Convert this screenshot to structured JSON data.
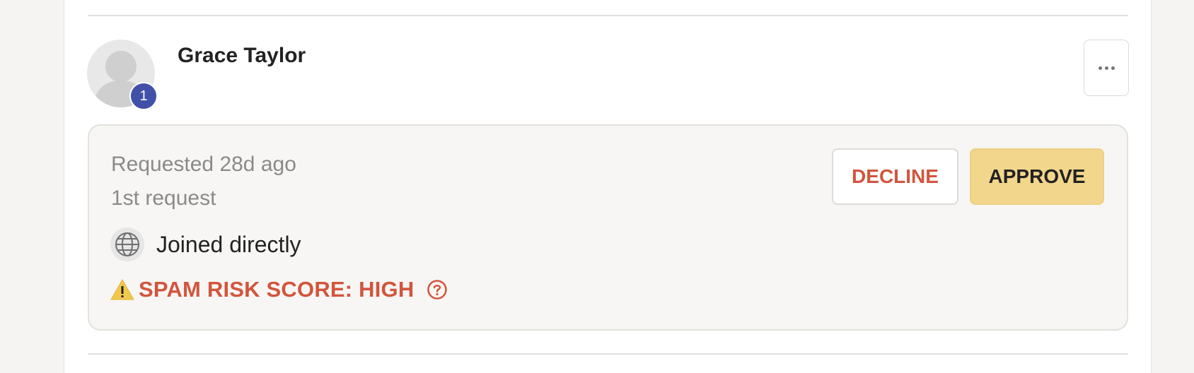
{
  "member": {
    "name": "Grace Taylor",
    "badge_count": "1",
    "avatar_icon": "user-silhouette-icon",
    "menu_icon": "more-horizontal-icon"
  },
  "request": {
    "requested": "Requested 28d ago",
    "count_text": "1st request",
    "join_method": "Joined directly",
    "join_icon": "globe-icon",
    "spam": {
      "icon": "warning-icon",
      "text": "SPAM RISK SCORE: HIGH",
      "help_icon": "question-circle-icon"
    }
  },
  "actions": {
    "decline_label": "DECLINE",
    "approve_label": "APPROVE"
  },
  "colors": {
    "badge": "#3f51a8",
    "danger": "#d2553d",
    "approve_bg": "#f2d68c",
    "card_bg": "#f7f6f4"
  }
}
